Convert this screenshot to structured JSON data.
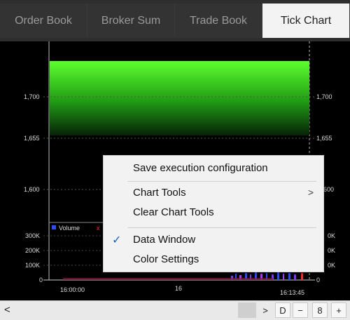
{
  "tabs": [
    {
      "label": "Order Book",
      "active": false
    },
    {
      "label": "Broker Sum",
      "active": false
    },
    {
      "label": "Trade Book",
      "active": false
    },
    {
      "label": "Tick Chart",
      "active": true
    }
  ],
  "chart": {
    "price_labels_left": [
      "1,700",
      "1,655",
      "1,600"
    ],
    "price_labels_right": [
      "1,700",
      "1,655",
      "600"
    ],
    "volume_labels_left": [
      "300K",
      "200K",
      "100K",
      "0"
    ],
    "volume_labels_right": [
      "0K",
      "0K",
      "0K",
      "0"
    ],
    "volume_legend": "Volume",
    "time_labels": [
      "16:00:00",
      "16",
      "16:13:45"
    ],
    "colors": {
      "area_top": "#5cff2e",
      "area_bottom": "#0a3a0a",
      "volume_bar": "#2b4cff",
      "accent_red": "#ff2a2a"
    }
  },
  "context_menu": {
    "items": [
      {
        "label": "Save execution configuration",
        "submenu": false,
        "checked": false
      },
      {
        "label": "Chart Tools",
        "submenu": true,
        "checked": false
      },
      {
        "label": "Clear Chart Tools",
        "submenu": false,
        "checked": false
      },
      {
        "label": "Data Window",
        "submenu": false,
        "checked": true
      },
      {
        "label": "Color Settings",
        "submenu": false,
        "checked": false
      }
    ],
    "submenu_arrow": ">",
    "check_mark": "✓"
  },
  "toolbar": {
    "scroll_left": "<",
    "scroll_right": ">",
    "period_label": "D",
    "zoom_out": "−",
    "count": "8",
    "zoom_in": "+"
  }
}
